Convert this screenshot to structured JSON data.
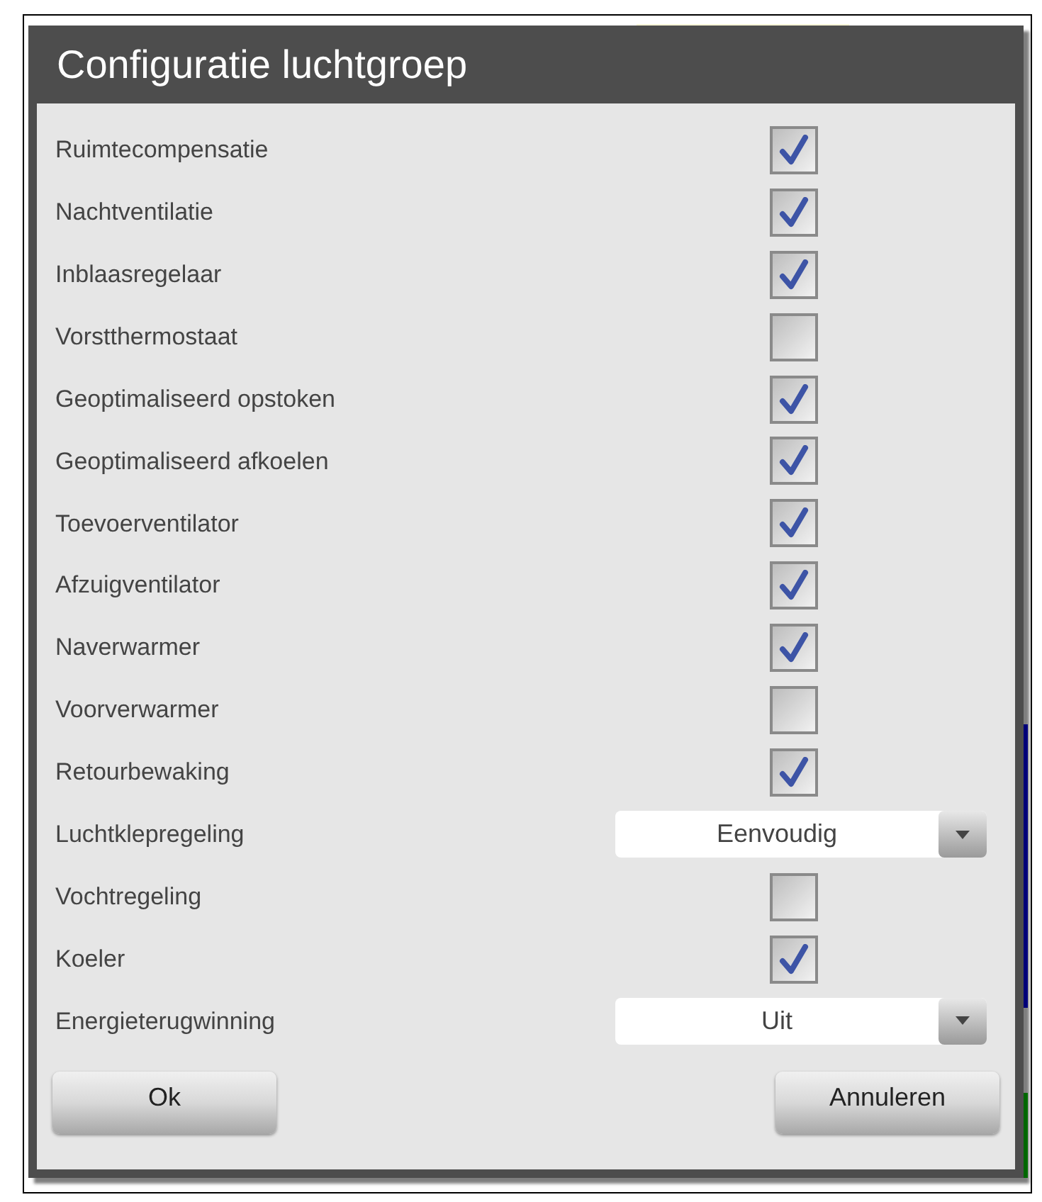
{
  "dialog": {
    "title": "Configuratie luchtgroep"
  },
  "rows": [
    {
      "kind": "checkbox",
      "label": "Ruimtecompensatie",
      "checked": true
    },
    {
      "kind": "checkbox",
      "label": "Nachtventilatie",
      "checked": true
    },
    {
      "kind": "checkbox",
      "label": "Inblaasregelaar",
      "checked": true
    },
    {
      "kind": "checkbox",
      "label": "Vorstthermostaat",
      "checked": false
    },
    {
      "kind": "checkbox",
      "label": "Geoptimaliseerd opstoken",
      "checked": true
    },
    {
      "kind": "checkbox",
      "label": "Geoptimaliseerd afkoelen",
      "checked": true
    },
    {
      "kind": "checkbox",
      "label": "Toevoerventilator",
      "checked": true
    },
    {
      "kind": "checkbox",
      "label": "Afzuigventilator",
      "checked": true
    },
    {
      "kind": "checkbox",
      "label": "Naverwarmer",
      "checked": true
    },
    {
      "kind": "checkbox",
      "label": "Voorverwarmer",
      "checked": false
    },
    {
      "kind": "checkbox",
      "label": "Retourbewaking",
      "checked": true
    },
    {
      "kind": "dropdown",
      "label": "Luchtklepregeling",
      "value": "Eenvoudig"
    },
    {
      "kind": "checkbox",
      "label": "Vochtregeling",
      "checked": false
    },
    {
      "kind": "checkbox",
      "label": "Koeler",
      "checked": true
    },
    {
      "kind": "dropdown",
      "label": "Energieterugwinning",
      "value": "Uit"
    }
  ],
  "buttons": [
    "Ok",
    "Annuleren"
  ]
}
